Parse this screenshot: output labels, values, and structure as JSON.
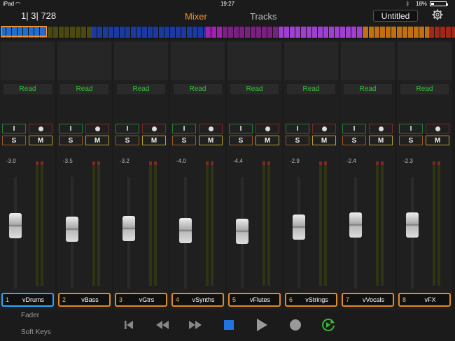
{
  "status_bar": {
    "device": "iPad",
    "time": "19:27",
    "battery": "18%",
    "battery_level": 0.18
  },
  "header": {
    "position": "1| 3| 728",
    "tabs": [
      {
        "label": "Mixer",
        "active": true
      },
      {
        "label": "Tracks",
        "active": false
      }
    ],
    "project_title": "Untitled",
    "settings_icon": "gear-icon"
  },
  "overview_colors": [
    "#1f6fd0",
    "#4a4a10",
    "#1a3aa0",
    "#a020b0",
    "#7a2080",
    "#a040d0",
    "#c07010",
    "#a02818"
  ],
  "strips": [
    {
      "number": "1",
      "name": "vDrums",
      "automation": "Read",
      "volume": "-3.0",
      "input": "I",
      "solo": "S",
      "mute": "M",
      "fader_level": 0.56,
      "selected": true
    },
    {
      "number": "2",
      "name": "vBass",
      "automation": "Read",
      "volume": "-3.5",
      "input": "I",
      "solo": "S",
      "mute": "M",
      "fader_level": 0.53,
      "selected": false
    },
    {
      "number": "3",
      "name": "vGtrs",
      "automation": "Read",
      "volume": "-3.2",
      "input": "I",
      "solo": "S",
      "mute": "M",
      "fader_level": 0.54,
      "selected": false
    },
    {
      "number": "4",
      "name": "vSynths",
      "automation": "Read",
      "volume": "-4.0",
      "input": "I",
      "solo": "S",
      "mute": "M",
      "fader_level": 0.52,
      "selected": false
    },
    {
      "number": "5",
      "name": "vFlutes",
      "automation": "Read",
      "volume": "-4.4",
      "input": "I",
      "solo": "S",
      "mute": "M",
      "fader_level": 0.51,
      "selected": false
    },
    {
      "number": "6",
      "name": "vStrings",
      "automation": "Read",
      "volume": "-2.9",
      "input": "I",
      "solo": "S",
      "mute": "M",
      "fader_level": 0.55,
      "selected": false
    },
    {
      "number": "7",
      "name": "vVocals",
      "automation": "Read",
      "volume": "-2.4",
      "input": "I",
      "solo": "S",
      "mute": "M",
      "fader_level": 0.57,
      "selected": false
    },
    {
      "number": "8",
      "name": "vFX",
      "automation": "Read",
      "volume": "-2.3",
      "input": "I",
      "solo": "S",
      "mute": "M",
      "fader_level": 0.57,
      "selected": false
    }
  ],
  "footer": {
    "fader_label": "Fader",
    "soft_keys_label": "Soft Keys"
  },
  "transport": [
    "skip-back-icon",
    "rewind-icon",
    "fast-forward-icon",
    "stop-icon",
    "play-icon",
    "record-icon",
    "cycle-icon"
  ],
  "colors": {
    "accent": "#f0922e",
    "selected": "#2aa8ff",
    "stop": "#1f74e0",
    "cycle": "#3ab53a"
  }
}
